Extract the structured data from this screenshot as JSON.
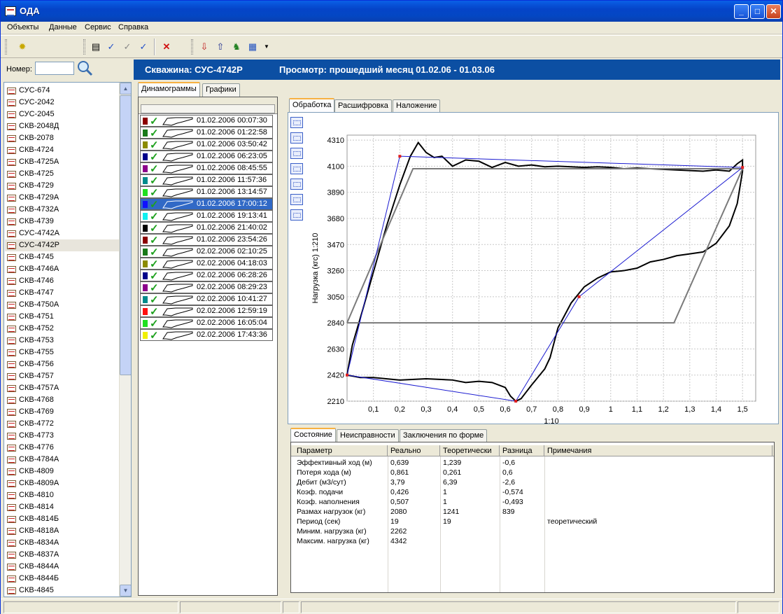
{
  "app": {
    "title": "ОДА",
    "min": "_",
    "max": "□",
    "close": "✕"
  },
  "menu": [
    "Объекты",
    "Данные",
    "Сервис",
    "Справка"
  ],
  "search": {
    "label": "Номер:",
    "value": ""
  },
  "wells": [
    "СУС-674",
    "СУС-2042",
    "СУС-2045",
    "СКВ-2048Д",
    "СКВ-2078",
    "СКВ-4724",
    "СКВ-4725А",
    "СКВ-4725",
    "СКВ-4729",
    "СКВ-4729А",
    "СКВ-4732А",
    "СКВ-4739",
    "СУС-4742А",
    "СУС-4742Р",
    "СКВ-4745",
    "СКВ-4746А",
    "СКВ-4746",
    "СКВ-4747",
    "СКВ-4750А",
    "СКВ-4751",
    "СКВ-4752",
    "СКВ-4753",
    "СКВ-4755",
    "СКВ-4756",
    "СКВ-4757",
    "СКВ-4757А",
    "СКВ-4768",
    "СКВ-4769",
    "СКВ-4772",
    "СКВ-4773",
    "СКВ-4776",
    "СКВ-4784А",
    "СКВ-4809",
    "СКВ-4809А",
    "СКВ-4810",
    "СКВ-4814",
    "СКВ-4814Б",
    "СКВ-4818А",
    "СКВ-4834А",
    "СКВ-4837А",
    "СКВ-4844А",
    "СКВ-4844Б",
    "СКВ-4845"
  ],
  "selected_well": "СУС-4742Р",
  "header": {
    "well": "Скважина: СУС-4742Р",
    "view": "Просмотр: прошедший месяц 01.02.06 - 01.03.06"
  },
  "left_tabs": [
    "Динамограммы",
    "Графики"
  ],
  "right_tabs": [
    "Обработка",
    "Расшифровка",
    "Наложение"
  ],
  "bottom_tabs": [
    "Состояние",
    "Неисправности",
    "Заключения по форме"
  ],
  "dynamograms": [
    {
      "ts": "01.02.2006 00:07:30",
      "color": "#8b0000"
    },
    {
      "ts": "01.02.2006 01:22:58",
      "color": "#1a7a1a"
    },
    {
      "ts": "01.02.2006 03:50:42",
      "color": "#8b8b00"
    },
    {
      "ts": "01.02.2006 06:23:05",
      "color": "#00008b"
    },
    {
      "ts": "01.02.2006 08:45:55",
      "color": "#8b008b"
    },
    {
      "ts": "01.02.2006 11:57:36",
      "color": "#008b8b"
    },
    {
      "ts": "01.02.2006 13:14:57",
      "color": "#20e020"
    },
    {
      "ts": "01.02.2006 17:00:12",
      "color": "#1010ff",
      "selected": true
    },
    {
      "ts": "01.02.2006 19:13:41",
      "color": "#10f0f0"
    },
    {
      "ts": "01.02.2006 21:40:02",
      "color": "#000000"
    },
    {
      "ts": "01.02.2006 23:54:26",
      "color": "#8b0000"
    },
    {
      "ts": "02.02.2006 02:10:25",
      "color": "#1a7a1a"
    },
    {
      "ts": "02.02.2006 04:18:03",
      "color": "#8b8b00"
    },
    {
      "ts": "02.02.2006 06:28:26",
      "color": "#00008b"
    },
    {
      "ts": "02.02.2006 08:29:23",
      "color": "#8b008b"
    },
    {
      "ts": "02.02.2006 10:41:27",
      "color": "#008b8b"
    },
    {
      "ts": "02.02.2006 12:59:19",
      "color": "#ff1010"
    },
    {
      "ts": "02.02.2006 16:05:04",
      "color": "#20e020"
    },
    {
      "ts": "02.02.2006 17:43:36",
      "color": "#f0f000"
    }
  ],
  "chart_data": {
    "type": "line",
    "xlabel": "1:10",
    "ylabel": "Нагрузка (кгс)  1:210",
    "xlim": [
      0,
      1.55
    ],
    "ylim": [
      2210,
      4350
    ],
    "x_ticks": [
      "0,1",
      "0,2",
      "0,3",
      "0,4",
      "0,5",
      "0,6",
      "0,7",
      "0,8",
      "0,9",
      "1",
      "1,1",
      "1,2",
      "1,3",
      "1,4",
      "1,5"
    ],
    "y_ticks": [
      "4310",
      "4100",
      "3890",
      "3680",
      "3470",
      "3260",
      "3050",
      "2840",
      "2630",
      "2420",
      "2210"
    ],
    "grid": true,
    "series": [
      {
        "color": "#000000",
        "x": [
          0.0,
          0.02,
          0.06,
          0.1,
          0.15,
          0.2,
          0.24,
          0.27,
          0.3,
          0.33,
          0.36,
          0.4,
          0.45,
          0.5,
          0.55,
          0.6,
          0.65,
          0.7,
          0.75,
          0.8,
          0.85,
          0.9,
          0.95,
          1.0,
          1.05,
          1.1,
          1.15,
          1.2,
          1.25,
          1.3,
          1.35,
          1.4,
          1.45,
          1.48,
          1.5,
          1.5,
          1.48,
          1.45,
          1.4,
          1.35,
          1.3,
          1.25,
          1.2,
          1.15,
          1.1,
          1.05,
          1.0,
          0.95,
          0.9,
          0.85,
          0.8,
          0.77,
          0.75,
          0.7,
          0.66,
          0.64,
          0.62,
          0.6,
          0.55,
          0.5,
          0.45,
          0.4,
          0.3,
          0.2,
          0.1,
          0.05,
          0.0,
          0.0
        ],
        "y": [
          2420,
          2660,
          2950,
          3250,
          3620,
          3950,
          4180,
          4290,
          4210,
          4170,
          4180,
          4100,
          4150,
          4140,
          4090,
          4130,
          4100,
          4110,
          4095,
          4100,
          4095,
          4090,
          4095,
          4090,
          4080,
          4085,
          4080,
          4075,
          4070,
          4065,
          4060,
          4070,
          4060,
          4120,
          4150,
          4060,
          3800,
          3620,
          3480,
          3410,
          3395,
          3380,
          3350,
          3330,
          3280,
          3260,
          3250,
          3200,
          3130,
          3000,
          2800,
          2560,
          2470,
          2340,
          2230,
          2210,
          2250,
          2320,
          2360,
          2370,
          2360,
          2380,
          2390,
          2380,
          2400,
          2400,
          2420,
          2420
        ]
      },
      {
        "color": "#7a7a7a",
        "x": [
          0.0,
          0.25,
          1.5,
          1.24,
          0.0
        ],
        "y": [
          2840,
          4080,
          4080,
          2840,
          2840
        ]
      },
      {
        "color": "#1a1ad0",
        "x": [
          0.0,
          0.2,
          1.5,
          0.88,
          0.64,
          0.0
        ],
        "y": [
          2420,
          4180,
          4090,
          3050,
          2210,
          2420
        ]
      }
    ],
    "markers": [
      {
        "x": 0.2,
        "y": 4180
      },
      {
        "x": 1.5,
        "y": 4090
      },
      {
        "x": 0.88,
        "y": 3050
      },
      {
        "x": 0.64,
        "y": 2210
      },
      {
        "x": 0.0,
        "y": 2420
      }
    ]
  },
  "table": {
    "headers": [
      "Параметр",
      "Реально",
      "Теоретически",
      "Разница",
      "Примечания"
    ],
    "rows": [
      [
        "Эффективный ход (м)",
        "0,639",
        "1,239",
        "-0,6",
        ""
      ],
      [
        "Потеря хода (м)",
        "0,861",
        "0,261",
        "0,6",
        ""
      ],
      [
        "Дебит (м3/сут)",
        "3,79",
        "6,39",
        "-2,6",
        ""
      ],
      [
        "Коэф. подачи",
        "0,426",
        "1",
        "-0,574",
        ""
      ],
      [
        "Коэф. наполнения",
        "0,507",
        "1",
        "-0,493",
        ""
      ],
      [
        "Размах нагрузок (кг)",
        "2080",
        "1241",
        "839",
        ""
      ],
      [
        "Период (сек)",
        "19",
        "19",
        "",
        "теоретический"
      ],
      [
        "Миним. нагрузка (кг)",
        "2262",
        "",
        "",
        ""
      ],
      [
        "Максим. нагрузка (кг)",
        "4342",
        "",
        "",
        ""
      ]
    ]
  }
}
